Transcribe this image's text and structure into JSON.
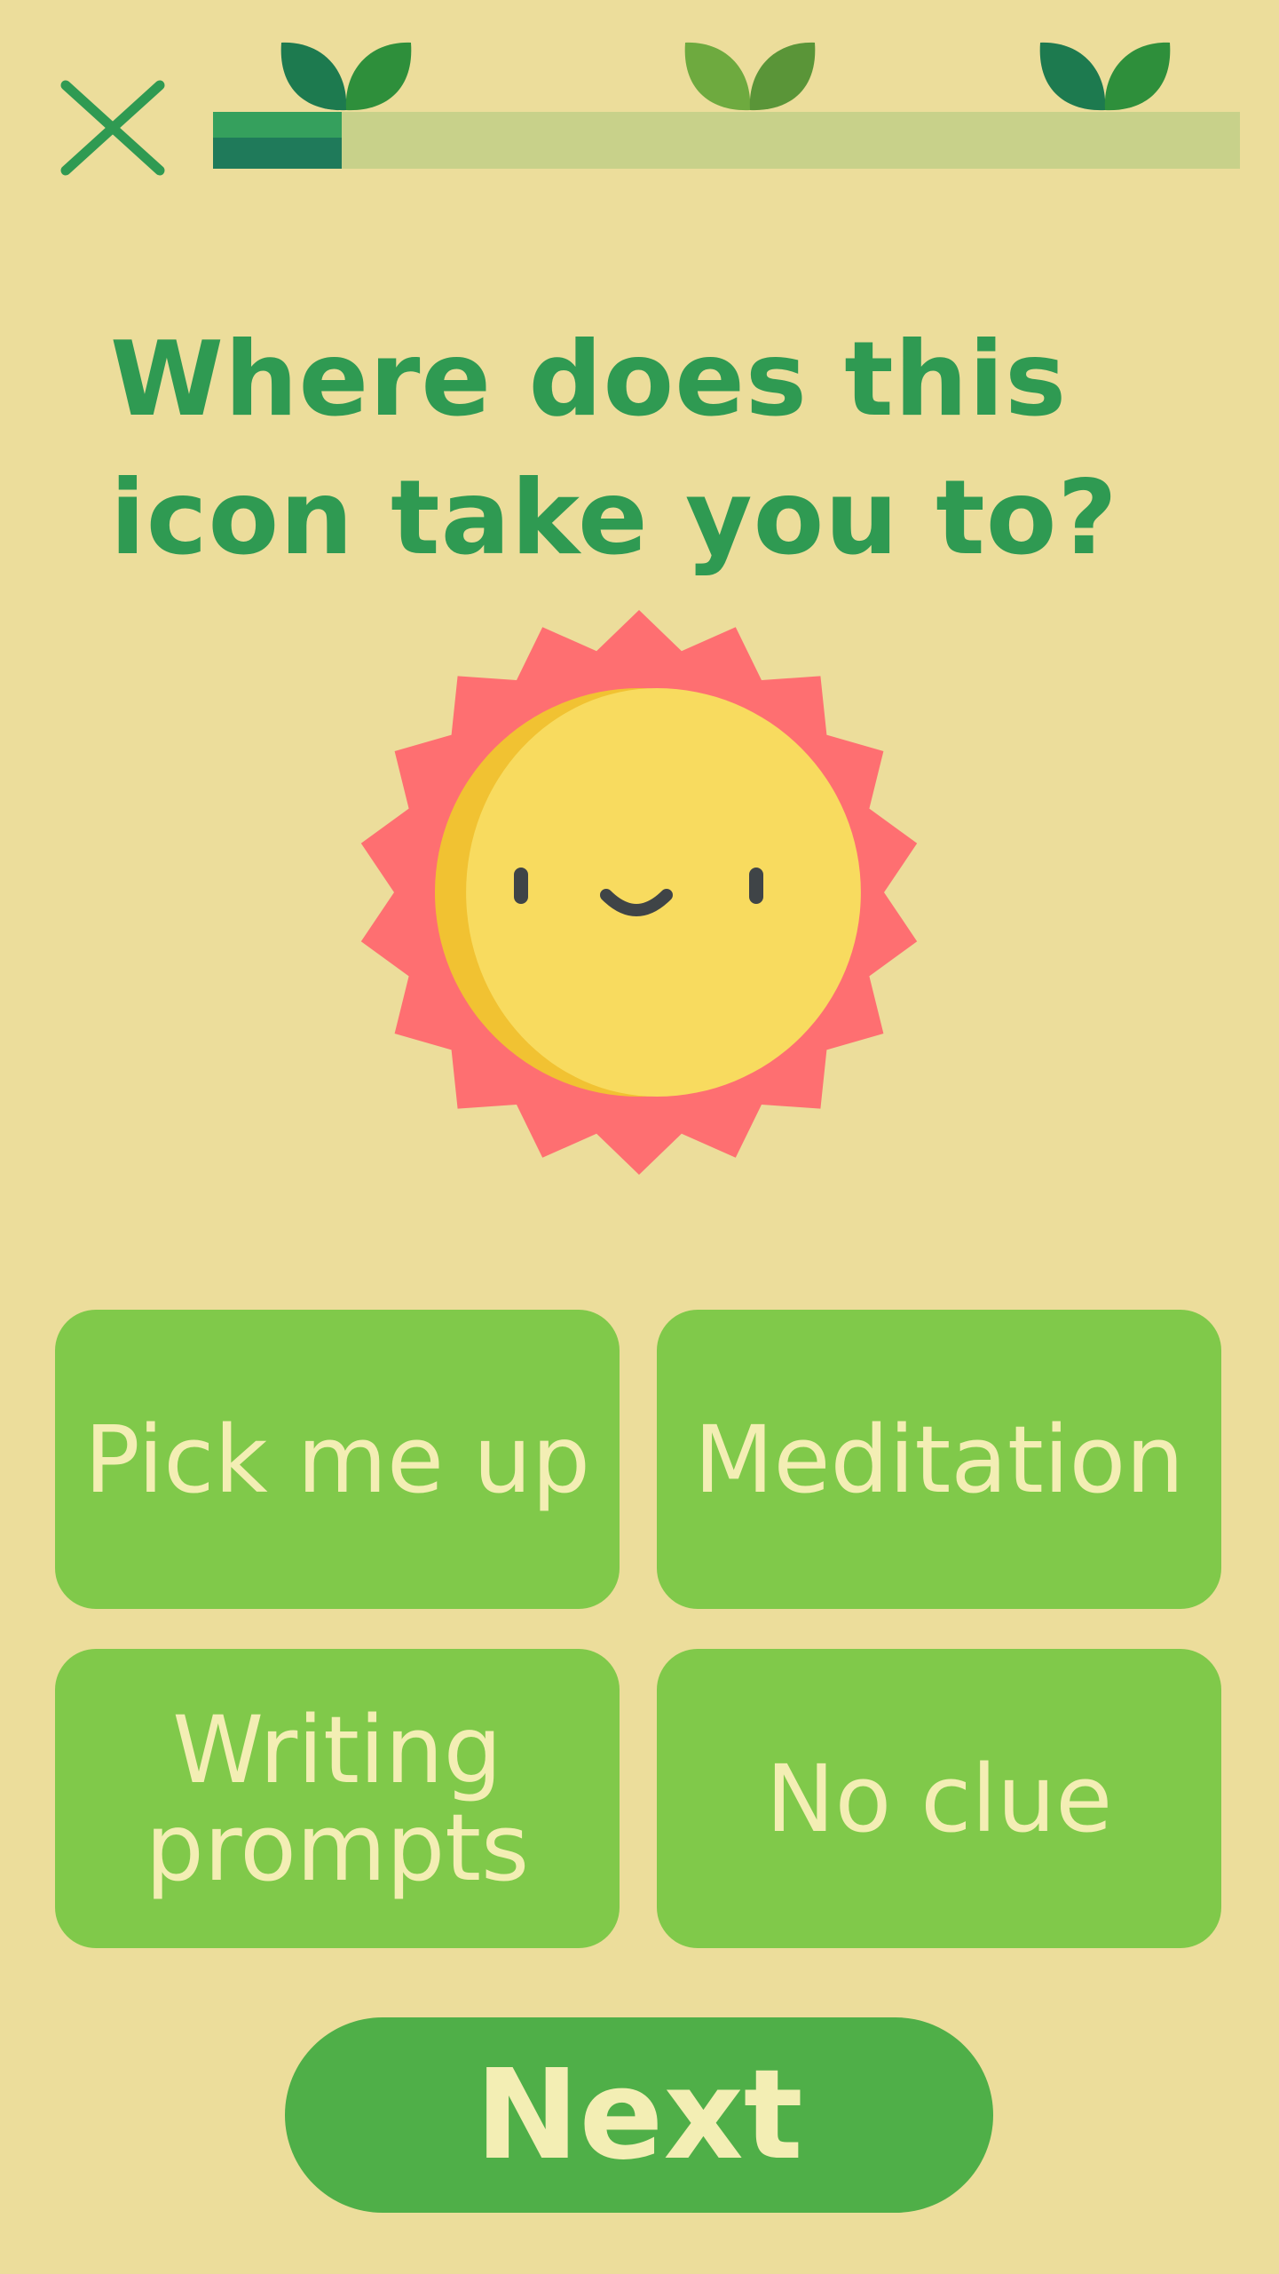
{
  "header": {
    "close_icon": "close-x-icon",
    "progress": {
      "value": 0.125,
      "milestone_icon": "sprout-leaves-icon",
      "milestones": 3
    }
  },
  "question": {
    "text": "Where does this icon take you to?"
  },
  "illustration": {
    "icon": "smiling-sun-icon"
  },
  "options": [
    {
      "label": "Pick me up"
    },
    {
      "label": "Meditation"
    },
    {
      "label": "Writing prompts"
    },
    {
      "label": "No clue"
    }
  ],
  "next_button": {
    "label": "Next"
  },
  "colors": {
    "background": "#ecdd9b",
    "accent_green": "#2f9a52",
    "option_green": "#80c94a",
    "button_green": "#4faf48",
    "light_text": "#f3eeb4",
    "sun_ray": "#fe6f71",
    "sun_face": "#f8db5f"
  }
}
